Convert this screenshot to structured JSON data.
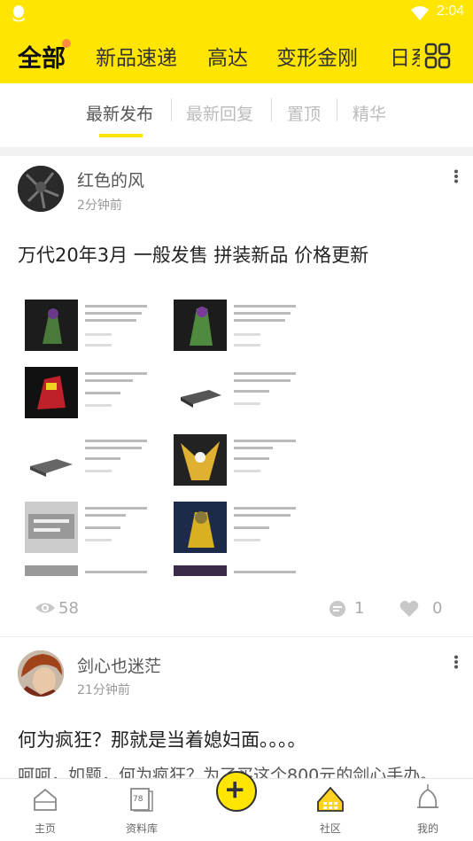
{
  "status_bar": {
    "time": "2:04"
  },
  "top_tabs": [
    "全部",
    "新品速递",
    "高达",
    "变形金刚",
    "日系"
  ],
  "sub_tabs": [
    "最新发布",
    "最新回复",
    "置顶",
    "精华"
  ],
  "posts": [
    {
      "username": "红色的风",
      "time": "2分钟前",
      "title": "万代20年3月 一般发售 拼装新品 价格更新",
      "views": "58",
      "comments": "1",
      "likes": "0"
    },
    {
      "username": "剑心也迷茫",
      "time": "21分钟前",
      "title": "何为疯狂？那就是当着媳妇面。。。。",
      "excerpt": "呵呵，如题，何为疯狂？为了买这个800元的剑心手办。"
    }
  ],
  "bottom_nav": {
    "items": [
      {
        "label": "主页",
        "icon": "home-icon"
      },
      {
        "label": "资料库",
        "icon": "library-icon",
        "badge": "78"
      },
      {
        "label": "社区",
        "icon": "community-icon"
      },
      {
        "label": "我的",
        "icon": "profile-icon"
      }
    ],
    "center_icon": "add-icon"
  },
  "colors": {
    "accent": "#FFE500",
    "dot": "#FF8C42"
  }
}
